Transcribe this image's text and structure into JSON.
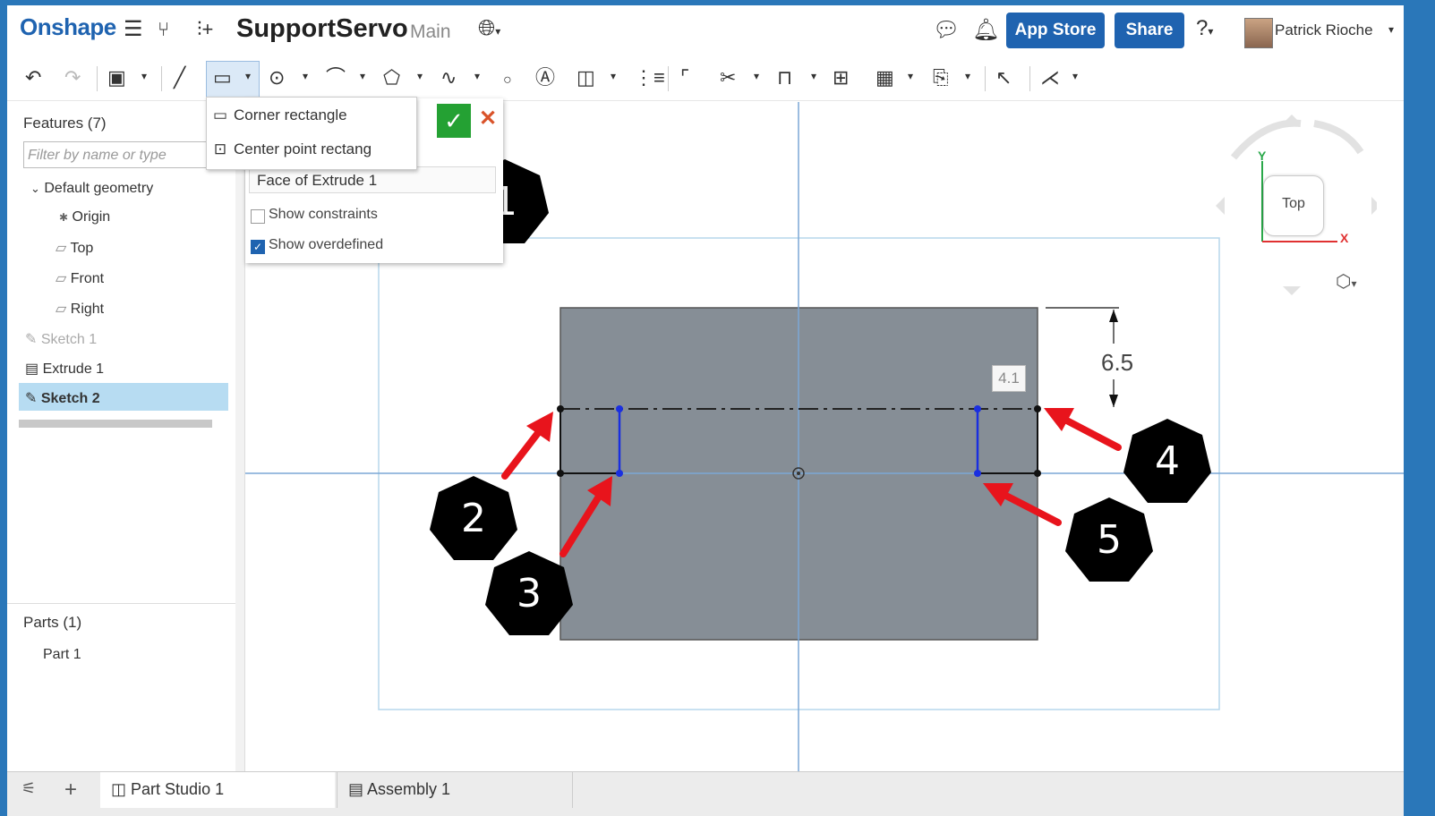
{
  "app": {
    "logo": "Onshape"
  },
  "document": {
    "title": "SupportServo",
    "branch": "Main"
  },
  "header": {
    "app_store": "App Store",
    "share": "Share",
    "user": "Patrick Rioche"
  },
  "rect_menu": {
    "items": [
      {
        "label": "Corner rectangle"
      },
      {
        "label": "Center point rectang"
      }
    ]
  },
  "sketch_dialog": {
    "plane": "Face of Extrude 1",
    "show_constraints": "Show constraints",
    "show_overdefined": "Show overdefined"
  },
  "features": {
    "title": "Features (7)",
    "filter_placeholder": "Filter by name or type",
    "items": [
      {
        "label": "Default geometry"
      },
      {
        "label": "Origin"
      },
      {
        "label": "Top"
      },
      {
        "label": "Front"
      },
      {
        "label": "Right"
      },
      {
        "label": "Sketch 1"
      },
      {
        "label": "Extrude 1"
      },
      {
        "label": "Sketch 2"
      }
    ]
  },
  "parts": {
    "title": "Parts (1)",
    "items": [
      {
        "label": "Part 1"
      }
    ]
  },
  "tabs": [
    {
      "label": "Part Studio 1"
    },
    {
      "label": "Assembly 1"
    }
  ],
  "viewcube": {
    "face": "Top",
    "x_axis": "X",
    "y_axis": "Y"
  },
  "dimensions": {
    "vertical": "6.5",
    "box": "4.1"
  },
  "callouts": [
    "1",
    "2",
    "3",
    "4",
    "5"
  ],
  "colors": {
    "brand": "#1f63b0",
    "accept": "#24a133",
    "cancel": "#d9532a",
    "selection": "#b7dcf2",
    "part_fill": "#868e96",
    "arrow": "#e8141c"
  }
}
